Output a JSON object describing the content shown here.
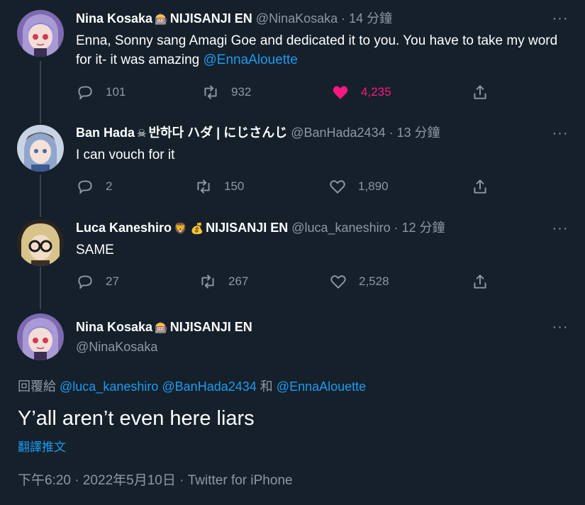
{
  "tweets": [
    {
      "name": "Nina Kosaka",
      "badge": "🎰",
      "suffix": "NIJISANJI EN",
      "handle": "@NinaKosaka",
      "time": "· 14 分鐘",
      "text": "Enna, Sonny sang Amagi Goe and dedicated it to you. You have to take my word for it- it was amazing",
      "mention": "@EnnaAlouette",
      "replies": "101",
      "retweets": "932",
      "likes": "4,235",
      "liked": true
    },
    {
      "name": "Ban Hada",
      "badge": "☠",
      "suffix": "반하다 ハダ | にじさんじ",
      "handle": "@BanHada2434",
      "time": "· 13 分鐘",
      "text": "I can vouch for it",
      "replies": "2",
      "retweets": "150",
      "likes": "1,890",
      "liked": false
    },
    {
      "name": "Luca Kaneshiro",
      "badge": "🦁 💰",
      "suffix": "NIJISANJI EN",
      "handle": "@luca_kaneshiro",
      "time": "· 12 分鐘",
      "text": "SAME",
      "replies": "27",
      "retweets": "267",
      "likes": "2,528",
      "liked": false
    }
  ],
  "main": {
    "name": "Nina Kosaka",
    "badge": "🎰",
    "suffix": "NIJISANJI EN",
    "handle": "@NinaKosaka",
    "reply_prefix": "回覆給",
    "reply_mention_1": "@luca_kaneshiro",
    "reply_mention_2": "@BanHada2434",
    "reply_and": "和",
    "reply_mention_3": "@EnnaAlouette",
    "text": "Y’all aren’t even here  liars",
    "translate": "翻譯推文",
    "timestamp": "下午6:20 · 2022年5月10日",
    "source": "Twitter for iPhone"
  },
  "colors": {
    "background": "#15202b",
    "text_secondary": "#8b98a5",
    "link": "#1d9bf0",
    "like": "#f91880"
  },
  "icons": {
    "reply": "reply-icon",
    "retweet": "retweet-icon",
    "like": "heart-icon",
    "share": "share-icon",
    "more": "more-icon"
  },
  "more_glyph": "···"
}
